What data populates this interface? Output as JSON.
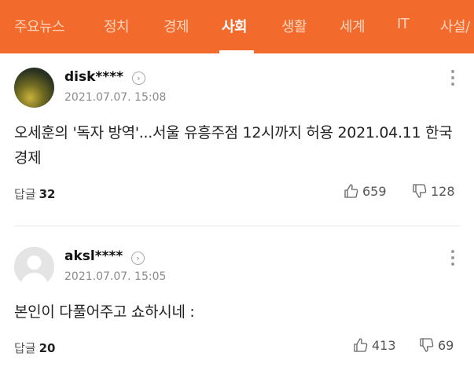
{
  "nav": {
    "tabs": [
      {
        "label": "주요뉴스"
      },
      {
        "label": "정치"
      },
      {
        "label": "경제"
      },
      {
        "label": "사회"
      },
      {
        "label": "생활"
      },
      {
        "label": "세계"
      },
      {
        "label": "IT"
      },
      {
        "label": "사설/"
      }
    ],
    "active_tab": "사회"
  },
  "comments": [
    {
      "username": "disk****",
      "timestamp": "2021.07.07. 15:08",
      "body": "오세훈의 '독자 방역'...서울 유흥주점 12시까지 허용 2021.04.11 한국경제",
      "reply_label": "답글",
      "reply_count": "32",
      "likes": "659",
      "dislikes": "128",
      "avatar": "photo"
    },
    {
      "username": "aksl****",
      "timestamp": "2021.07.07. 15:05",
      "body": "본인이 다풀어주고 쇼하시네 :",
      "reply_label": "답글",
      "reply_count": "20",
      "likes": "413",
      "dislikes": "69",
      "avatar": "default"
    }
  ],
  "colors": {
    "brand": "#f36b2c",
    "tab_inactive": "#ffd5bf"
  },
  "icons": [
    "chevron-right-icon",
    "more-vertical-icon",
    "thumbs-up-icon",
    "thumbs-down-icon",
    "default-avatar-icon"
  ]
}
